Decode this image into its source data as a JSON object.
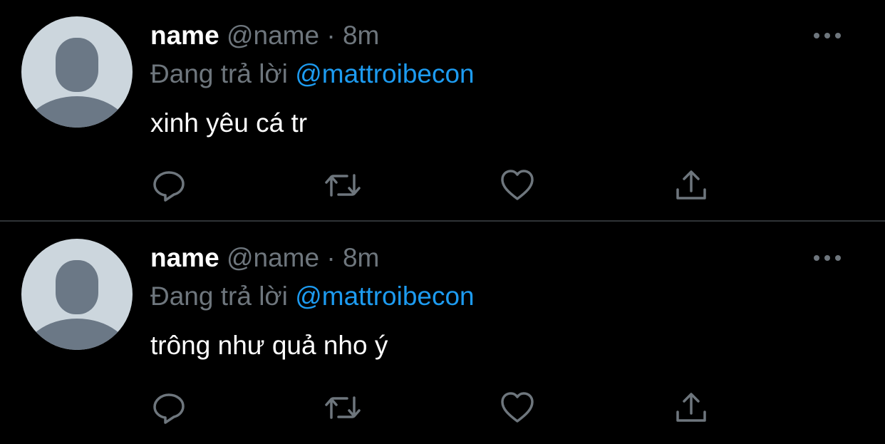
{
  "colors": {
    "background": "#000000",
    "primary_text": "#ffffff",
    "secondary_text": "#6e767d",
    "mention": "#1d9bf0",
    "divider": "#2f3336",
    "avatar_bg": "#ccd6dd",
    "avatar_figure": "#6b7886"
  },
  "tweets": [
    {
      "display_name": "name",
      "handle": "@name",
      "separator": "·",
      "time": "8m",
      "reply_prefix": "Đang trả lời",
      "reply_to": "@mattroibecon",
      "text": "xinh yêu cá tr",
      "icons": [
        "avatar-placeholder",
        "more-icon",
        "reply-icon",
        "retweet-icon",
        "like-icon",
        "share-icon"
      ]
    },
    {
      "display_name": "name",
      "handle": "@name",
      "separator": "·",
      "time": "8m",
      "reply_prefix": "Đang trả lời",
      "reply_to": "@mattroibecon",
      "text": "trông như quả nho ý",
      "icons": [
        "avatar-placeholder",
        "more-icon",
        "reply-icon",
        "retweet-icon",
        "like-icon",
        "share-icon"
      ]
    }
  ]
}
